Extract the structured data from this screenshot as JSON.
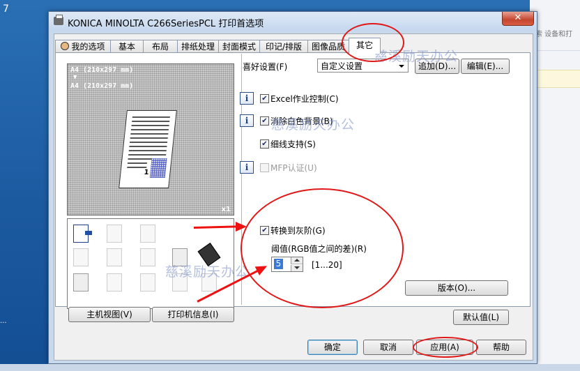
{
  "desktop": {
    "left_glyph": "7",
    "dots": "..."
  },
  "background_window": {
    "address_text": "索 设备和打"
  },
  "dialog": {
    "title": "KONICA MINOLTA C266SeriesPCL 打印首选项",
    "close_glyph": "✕",
    "tabs": [
      {
        "label": "我的选项",
        "active": false
      },
      {
        "label": "基本",
        "active": false
      },
      {
        "label": "布局",
        "active": false
      },
      {
        "label": "排纸处理",
        "active": false
      },
      {
        "label": "封面模式",
        "active": false
      },
      {
        "label": "印记/排版",
        "active": false
      },
      {
        "label": "图像品质",
        "active": false
      },
      {
        "label": "其它",
        "active": true
      }
    ],
    "preview": {
      "line1": "A4 (210x297 mm)",
      "arrow": "▼",
      "line2": "A4 (210x297 mm)",
      "page_number": "1",
      "copies": "x1"
    },
    "left_buttons": {
      "machine_view": "主机视图(V)",
      "printer_info": "打印机信息(I)"
    },
    "favorites": {
      "label": "喜好设置(F)",
      "selected": "自定义设置",
      "add": "追加(D)...",
      "edit": "编辑(E)..."
    },
    "info_glyph": "i",
    "checkboxes": [
      {
        "label": "Excel作业控制(C)",
        "checked": true,
        "enabled": true,
        "info": true
      },
      {
        "label": "消除白色背景(B)",
        "checked": true,
        "enabled": true,
        "info": true
      },
      {
        "label": "细线支持(S)",
        "checked": true,
        "enabled": true,
        "info": false
      },
      {
        "label": "MFP认证(U)",
        "checked": false,
        "enabled": false,
        "info": true
      },
      {
        "label": "转换到灰阶(G)",
        "checked": true,
        "enabled": true,
        "info": false
      }
    ],
    "check_glyph": "✔",
    "threshold": {
      "label": "阈值(RGB值之间的差)(R)",
      "value": "5",
      "range": "[1...20]"
    },
    "version_button": "版本(O)...",
    "defaults_button": "默认值(L)",
    "footer": {
      "ok": "确定",
      "cancel": "取消",
      "apply": "应用(A)",
      "help": "帮助"
    }
  },
  "watermarks": [
    "慈溪励天办公",
    "慈溪励天办公",
    "慈溪励天办公"
  ],
  "annotation_color": "#e01818"
}
